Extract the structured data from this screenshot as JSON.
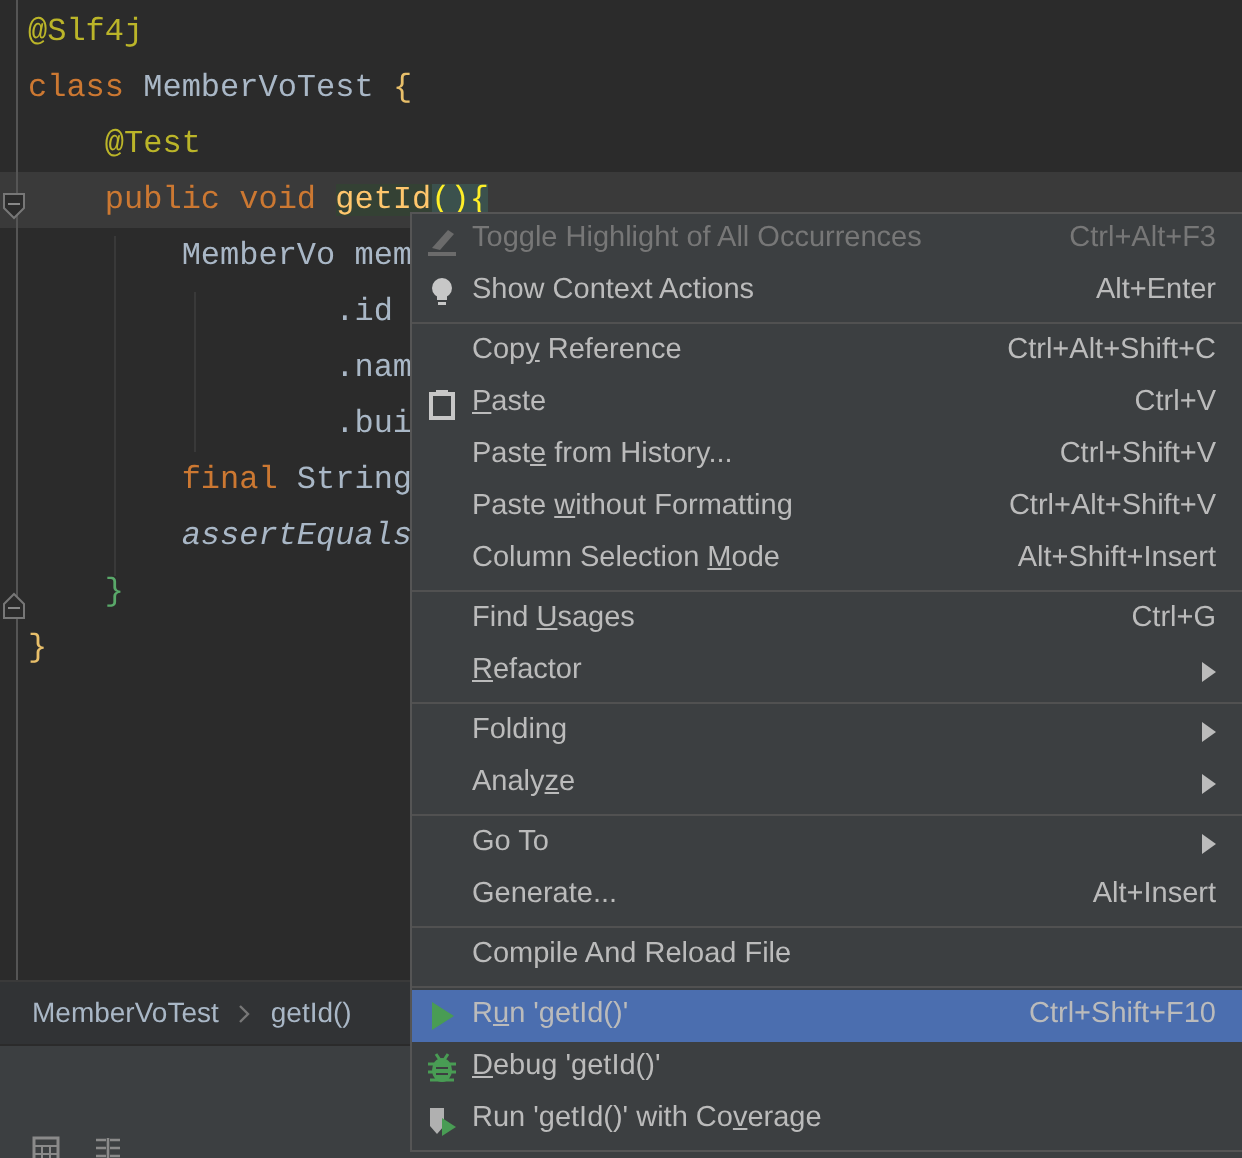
{
  "editor": {
    "lines": [
      {
        "current": false,
        "tokens": [
          {
            "text": "@Slf4j",
            "kind": "annotation"
          }
        ]
      },
      {
        "current": false,
        "tokens": [
          {
            "text": "class ",
            "kind": "keyword"
          },
          {
            "text": "MemberVoTest ",
            "kind": "ident"
          },
          {
            "text": "{",
            "kind": "brace"
          }
        ]
      },
      {
        "current": false,
        "tokens": [
          {
            "text": "    @Test",
            "kind": "annotation"
          }
        ]
      },
      {
        "current": true,
        "tokens": [
          {
            "text": "    public void ",
            "kind": "keyword"
          },
          {
            "text": "getId",
            "kind": "ident-highlighted"
          },
          {
            "text": "(){",
            "kind": "brace-matched"
          }
        ]
      },
      {
        "current": false,
        "tokens": [
          {
            "text": "        MemberVo mem",
            "kind": "ident"
          }
        ]
      },
      {
        "current": false,
        "tokens": [
          {
            "text": "                .id",
            "kind": "ident"
          }
        ]
      },
      {
        "current": false,
        "tokens": [
          {
            "text": "                .nam",
            "kind": "ident"
          }
        ]
      },
      {
        "current": false,
        "tokens": [
          {
            "text": "                .bui",
            "kind": "ident"
          }
        ]
      },
      {
        "current": false,
        "tokens": [
          {
            "text": "        final ",
            "kind": "keyword"
          },
          {
            "text": "String",
            "kind": "ident"
          }
        ]
      },
      {
        "current": false,
        "tokens": [
          {
            "text": "        assertEquals",
            "kind": "italic"
          }
        ]
      },
      {
        "current": false,
        "tokens": [
          {
            "text": "    }",
            "kind": "brace-inner"
          }
        ]
      },
      {
        "current": false,
        "tokens": [
          {
            "text": "}",
            "kind": "brace"
          }
        ]
      }
    ]
  },
  "breadcrumbs": [
    "MemberVoTest",
    "getId()"
  ],
  "context_menu": {
    "groups": [
      [
        {
          "kind": "toggle",
          "label": [
            {
              "text": "Toggle Highlight of All Occurrences",
              "mnemonic": false
            }
          ],
          "shortcut": "Ctrl+Alt+F3",
          "disabled": true,
          "selected": false,
          "submenu": false
        },
        {
          "kind": "context",
          "label": [
            {
              "text": "Show Context Actions",
              "mnemonic": false
            }
          ],
          "shortcut": "Alt+Enter",
          "disabled": false,
          "selected": false,
          "submenu": false
        }
      ],
      [
        {
          "kind": "plain",
          "label": [
            {
              "text": "Cop",
              "mnemonic": false
            },
            {
              "text": "y",
              "mnemonic": true
            },
            {
              "text": " Reference",
              "mnemonic": false
            }
          ],
          "shortcut": "Ctrl+Alt+Shift+C",
          "disabled": false,
          "selected": false,
          "submenu": false
        },
        {
          "kind": "paste",
          "label": [
            {
              "text": "P",
              "mnemonic": true
            },
            {
              "text": "aste",
              "mnemonic": false
            }
          ],
          "shortcut": "Ctrl+V",
          "disabled": false,
          "selected": false,
          "submenu": false
        },
        {
          "kind": "plain",
          "label": [
            {
              "text": "Past",
              "mnemonic": false
            },
            {
              "text": "e",
              "mnemonic": true
            },
            {
              "text": " from History...",
              "mnemonic": false
            }
          ],
          "shortcut": "Ctrl+Shift+V",
          "disabled": false,
          "selected": false,
          "submenu": false
        },
        {
          "kind": "plain",
          "label": [
            {
              "text": "Paste ",
              "mnemonic": false
            },
            {
              "text": "w",
              "mnemonic": true
            },
            {
              "text": "ithout Formatting",
              "mnemonic": false
            }
          ],
          "shortcut": "Ctrl+Alt+Shift+V",
          "disabled": false,
          "selected": false,
          "submenu": false
        },
        {
          "kind": "plain",
          "label": [
            {
              "text": "Column Selection ",
              "mnemonic": false
            },
            {
              "text": "M",
              "mnemonic": true
            },
            {
              "text": "ode",
              "mnemonic": false
            }
          ],
          "shortcut": "Alt+Shift+Insert",
          "disabled": false,
          "selected": false,
          "submenu": false
        }
      ],
      [
        {
          "kind": "plain",
          "label": [
            {
              "text": "Find ",
              "mnemonic": false
            },
            {
              "text": "U",
              "mnemonic": true
            },
            {
              "text": "sages",
              "mnemonic": false
            }
          ],
          "shortcut": "Ctrl+G",
          "disabled": false,
          "selected": false,
          "submenu": false
        },
        {
          "kind": "plain",
          "label": [
            {
              "text": "R",
              "mnemonic": true
            },
            {
              "text": "efactor",
              "mnemonic": false
            }
          ],
          "disabled": false,
          "selected": false,
          "submenu": true
        }
      ],
      [
        {
          "kind": "plain",
          "label": [
            {
              "text": "Folding",
              "mnemonic": false
            }
          ],
          "disabled": false,
          "selected": false,
          "submenu": true
        },
        {
          "kind": "plain",
          "label": [
            {
              "text": "Analy",
              "mnemonic": false
            },
            {
              "text": "z",
              "mnemonic": true
            },
            {
              "text": "e",
              "mnemonic": false
            }
          ],
          "disabled": false,
          "selected": false,
          "submenu": true
        }
      ],
      [
        {
          "kind": "plain",
          "label": [
            {
              "text": "Go To",
              "mnemonic": false
            }
          ],
          "disabled": false,
          "selected": false,
          "submenu": true
        },
        {
          "kind": "plain",
          "label": [
            {
              "text": "Generate...",
              "mnemonic": false
            }
          ],
          "shortcut": "Alt+Insert",
          "disabled": false,
          "selected": false,
          "submenu": false
        }
      ],
      [
        {
          "kind": "plain",
          "label": [
            {
              "text": "Compile And Reload File",
              "mnemonic": false
            }
          ],
          "disabled": false,
          "selected": false,
          "submenu": false
        }
      ],
      [
        {
          "kind": "run",
          "label": [
            {
              "text": "R",
              "mnemonic": false
            },
            {
              "text": "u",
              "mnemonic": true
            },
            {
              "text": "n 'getId()'",
              "mnemonic": false
            }
          ],
          "shortcut": "Ctrl+Shift+F10",
          "disabled": false,
          "selected": true,
          "submenu": false
        },
        {
          "kind": "debug",
          "label": [
            {
              "text": "D",
              "mnemonic": true
            },
            {
              "text": "ebug 'getId()'",
              "mnemonic": false
            }
          ],
          "disabled": false,
          "selected": false,
          "submenu": false
        },
        {
          "kind": "coverage",
          "label": [
            {
              "text": "Run 'getId()' with Co",
              "mnemonic": false
            },
            {
              "text": "v",
              "mnemonic": true
            },
            {
              "text": "erage",
              "mnemonic": false
            }
          ],
          "disabled": false,
          "selected": false,
          "submenu": false
        }
      ]
    ]
  }
}
